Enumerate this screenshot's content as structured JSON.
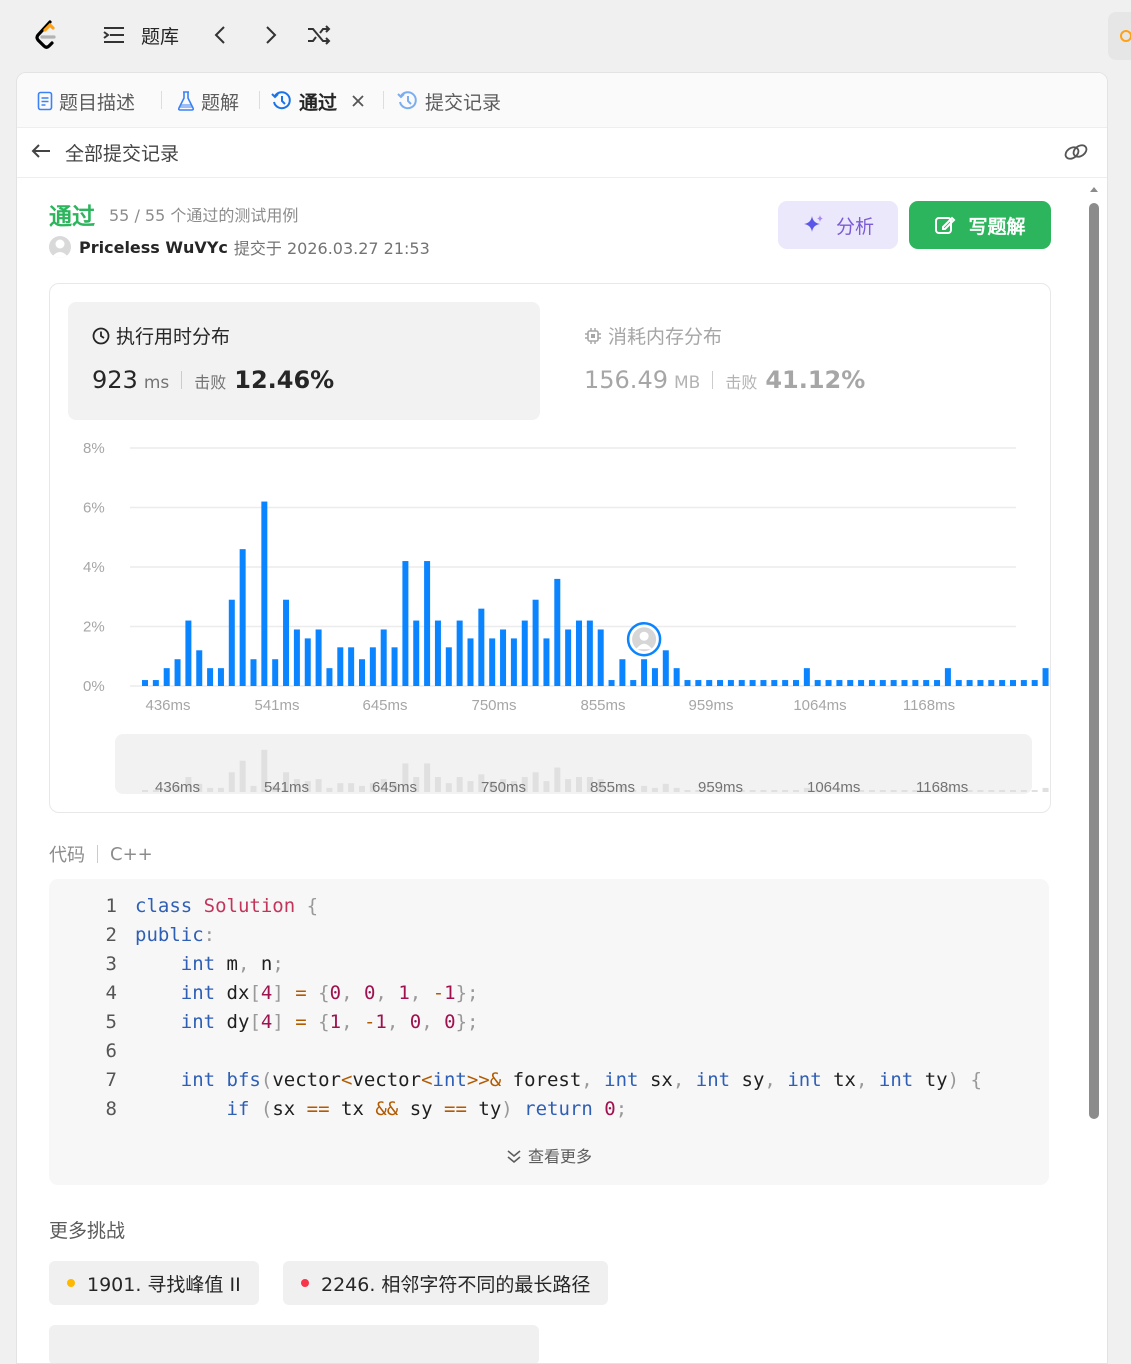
{
  "topbar": {
    "problem_bank": "题库"
  },
  "tabs": {
    "description": "题目描述",
    "solutions": "题解",
    "accepted": "通过",
    "submissions": "提交记录"
  },
  "back": {
    "title": "全部提交记录"
  },
  "result": {
    "status": "通过",
    "testcases": "55 / 55 个通过的测试用例",
    "user": "Priceless WuVYc",
    "submitted_at": "提交于 2026.03.27 21:53",
    "analyze_label": "分析",
    "write_solution_label": "写题解"
  },
  "runtime": {
    "title": "执行用时分布",
    "value": "923",
    "unit": "ms",
    "beat_label": "击败",
    "beat_value": "12.46%"
  },
  "memory": {
    "title": "消耗内存分布",
    "value": "156.49",
    "unit": "MB",
    "beat_label": "击败",
    "beat_value": "41.12%"
  },
  "chart_data": {
    "type": "bar",
    "yticks": [
      "8%",
      "6%",
      "4%",
      "2%",
      "0%"
    ],
    "ylim": [
      0,
      8
    ],
    "xticks": [
      "436ms",
      "541ms",
      "645ms",
      "750ms",
      "855ms",
      "959ms",
      "1064ms",
      "1168ms"
    ],
    "values": [
      0.2,
      0.2,
      0.6,
      0.9,
      2.2,
      1.2,
      0.6,
      0.6,
      2.9,
      4.6,
      0.9,
      6.2,
      0.9,
      2.9,
      1.9,
      1.6,
      1.9,
      0.6,
      1.3,
      1.3,
      0.9,
      1.3,
      1.9,
      1.3,
      4.2,
      2.2,
      4.2,
      2.2,
      1.3,
      2.2,
      1.6,
      2.6,
      1.6,
      1.9,
      1.6,
      2.2,
      2.9,
      1.6,
      3.6,
      1.9,
      2.2,
      2.2,
      1.9,
      0.2,
      0.9,
      0.2,
      0.9,
      0.6,
      1.2,
      0.6,
      0.2,
      0.2,
      0.2,
      0.2,
      0.2,
      0.2,
      0.2,
      0.2,
      0.2,
      0.2,
      0.2,
      0.6,
      0.2,
      0.2,
      0.2,
      0.2,
      0.2,
      0.2,
      0.2,
      0.2,
      0.2,
      0.2,
      0.2,
      0.2,
      0.6,
      0.2,
      0.2,
      0.2,
      0.2,
      0.2,
      0.2,
      0.2,
      0.2,
      0.6,
      0.2
    ],
    "current_index": 46,
    "bar_color": "#0a84ff"
  },
  "code": {
    "label": "代码",
    "language": "C++",
    "lines": [
      "class Solution {",
      "public:",
      "    int m, n;",
      "    int dx[4] = {0, 0, 1, -1};",
      "    int dy[4] = {1, -1, 0, 0};",
      "",
      "    int bfs(vector<vector<int>>& forest, int sx, int sy, int tx, int ty) {",
      "        if (sx == tx && sy == ty) return 0;"
    ],
    "show_more": "查看更多"
  },
  "more_challenges": {
    "title": "更多挑战",
    "items": [
      {
        "label": "1901. 寻找峰值 II",
        "color": "#ffb800"
      },
      {
        "label": "2246. 相邻字符不同的最长路径",
        "color": "#f8344a"
      }
    ]
  }
}
